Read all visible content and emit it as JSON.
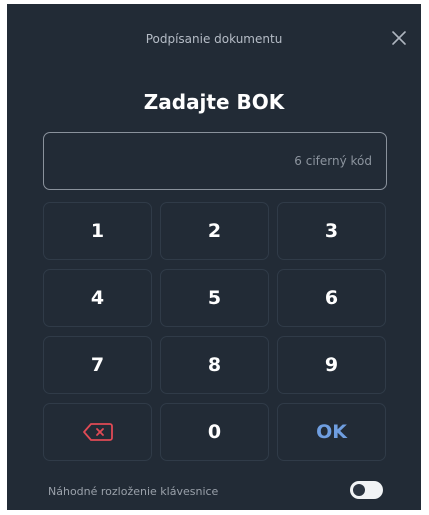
{
  "header": {
    "title": "Podpísanie dokumentu"
  },
  "main": {
    "title": "Zadajte BOK"
  },
  "pin_input": {
    "value": "",
    "placeholder": "6 ciferný kód"
  },
  "keypad": {
    "keys": [
      "1",
      "2",
      "3",
      "4",
      "5",
      "6",
      "7",
      "8",
      "9"
    ],
    "zero": "0",
    "ok": "OK",
    "backspace_icon": "backspace-icon"
  },
  "footer": {
    "random_layout_label": "Náhodné rozloženie klávesnice",
    "random_layout_enabled": false
  },
  "colors": {
    "background": "#222b36",
    "key_border": "#303b48",
    "ok_accent": "#6f9ee0",
    "backspace_red": "#e04a55"
  }
}
